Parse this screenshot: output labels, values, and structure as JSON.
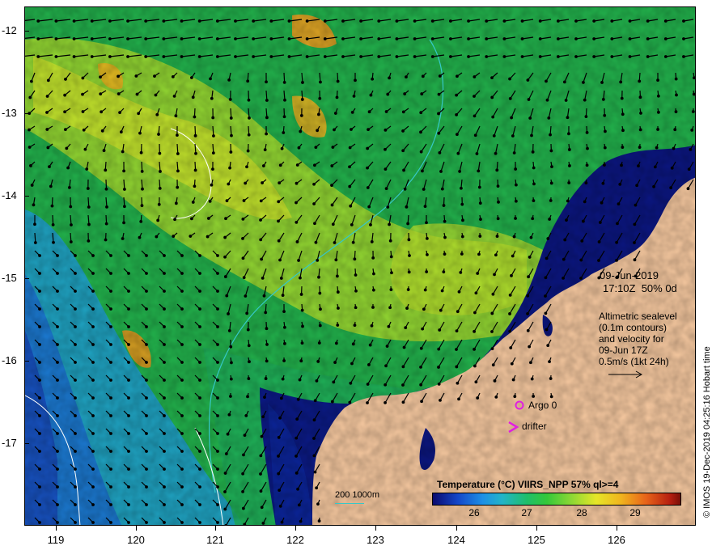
{
  "map": {
    "y_ticks": [
      "-12",
      "-13",
      "-14",
      "-15",
      "-16",
      "-17"
    ],
    "x_ticks": [
      "119",
      "120",
      "121",
      "122",
      "123",
      "124",
      "125",
      "126"
    ],
    "date_line1": "09-Jun-2019",
    "date_line2": "17:10Z  50% 0d",
    "altimetry_note": "Altimetric sealevel\n(0.1m contours)\nand velocity for\n09-Jun 17Z\n0.5m/s (1kt 24h)",
    "argo_label": "Argo 0",
    "drifter_label": "drifter",
    "scale_label": "200  1000m",
    "credit": "© IMOS 19-Dec-2019 04:25:16 Hobart time"
  },
  "colorbar": {
    "title": "Temperature (°C) VIIRS_NPP 57% ql>=4",
    "ticks": [
      "26",
      "27",
      "28",
      "29"
    ],
    "colors": [
      "#0a0a6e",
      "#1346c8",
      "#1e8fe6",
      "#22b4c8",
      "#1fbf6a",
      "#34c83a",
      "#8cd835",
      "#e6e628",
      "#f0b41e",
      "#e8641a",
      "#b41e10"
    ]
  },
  "legend": {
    "argo_color": "#e020e0",
    "drifter_color": "#e020e0",
    "land_color": "#f7c9a0",
    "contour_color": "#36c8c8"
  }
}
